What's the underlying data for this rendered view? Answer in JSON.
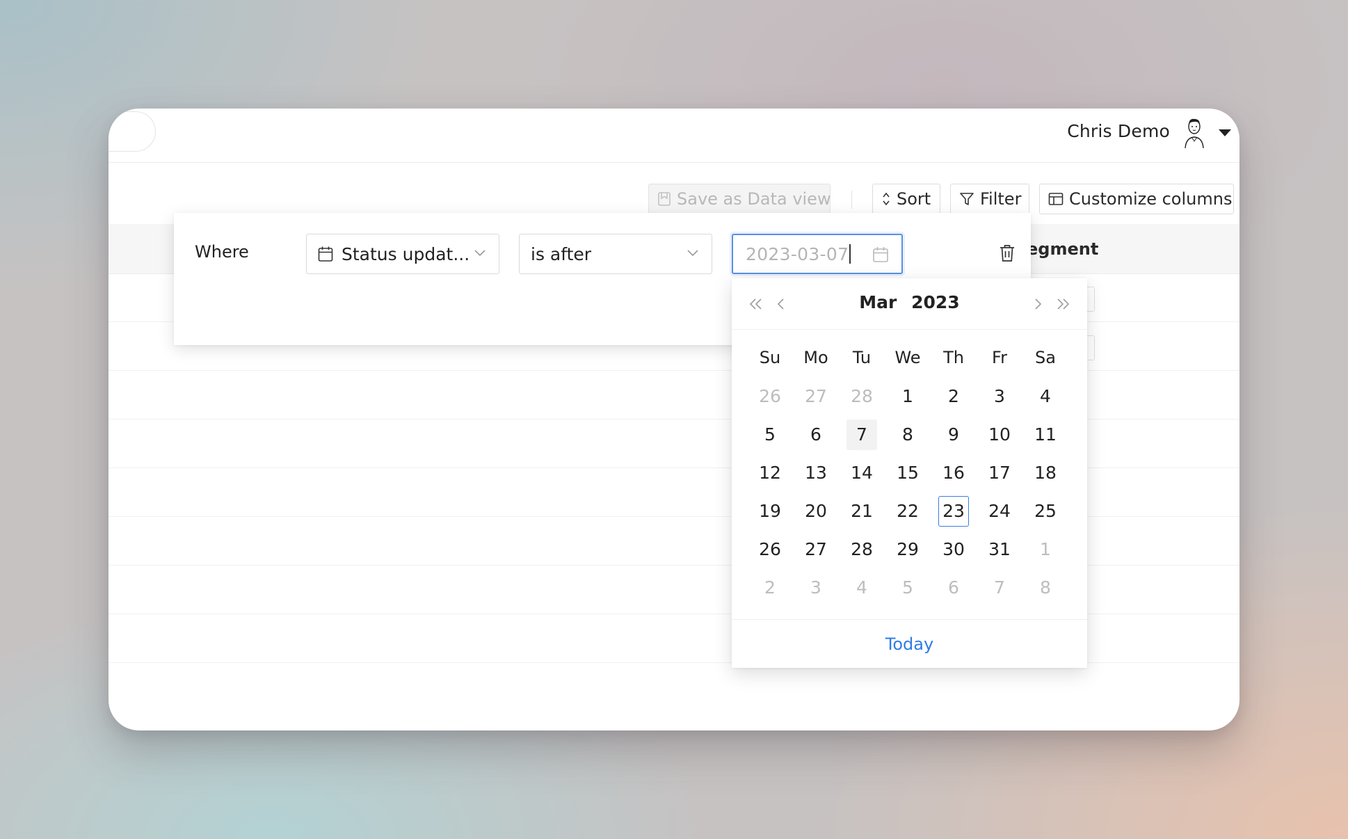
{
  "user": {
    "name": "Chris Demo"
  },
  "toolbar": {
    "save_label": "Save as Data view",
    "sort_label": "Sort",
    "filter_label": "Filter",
    "columns_label": "Customize columns"
  },
  "table": {
    "visible_header": "egment"
  },
  "filter": {
    "where_label": "Where",
    "field_value": "Status updat...",
    "operator_value": "is after",
    "date_value": "2023-03-07"
  },
  "calendar": {
    "month": "Mar",
    "year": "2023",
    "weekdays": [
      "Su",
      "Mo",
      "Tu",
      "We",
      "Th",
      "Fr",
      "Sa"
    ],
    "days": [
      {
        "d": "26",
        "muted": true
      },
      {
        "d": "27",
        "muted": true
      },
      {
        "d": "28",
        "muted": true
      },
      {
        "d": "1"
      },
      {
        "d": "2"
      },
      {
        "d": "3"
      },
      {
        "d": "4"
      },
      {
        "d": "5"
      },
      {
        "d": "6"
      },
      {
        "d": "7",
        "selected": true
      },
      {
        "d": "8"
      },
      {
        "d": "9"
      },
      {
        "d": "10"
      },
      {
        "d": "11"
      },
      {
        "d": "12"
      },
      {
        "d": "13"
      },
      {
        "d": "14"
      },
      {
        "d": "15"
      },
      {
        "d": "16"
      },
      {
        "d": "17"
      },
      {
        "d": "18"
      },
      {
        "d": "19"
      },
      {
        "d": "20"
      },
      {
        "d": "21"
      },
      {
        "d": "22"
      },
      {
        "d": "23",
        "today": true
      },
      {
        "d": "24"
      },
      {
        "d": "25"
      },
      {
        "d": "26"
      },
      {
        "d": "27"
      },
      {
        "d": "28"
      },
      {
        "d": "29"
      },
      {
        "d": "30"
      },
      {
        "d": "31"
      },
      {
        "d": "1",
        "muted": true
      },
      {
        "d": "2",
        "muted": true
      },
      {
        "d": "3",
        "muted": true
      },
      {
        "d": "4",
        "muted": true
      },
      {
        "d": "5",
        "muted": true
      },
      {
        "d": "6",
        "muted": true
      },
      {
        "d": "7",
        "muted": true
      },
      {
        "d": "8",
        "muted": true
      }
    ],
    "today_label": "Today"
  },
  "colors": {
    "accent": "#2f7be6",
    "focus_border": "#5b8fe0"
  }
}
